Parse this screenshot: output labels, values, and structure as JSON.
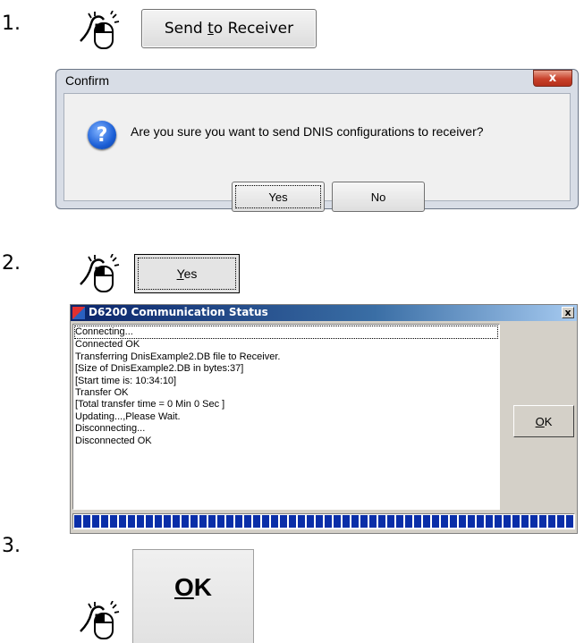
{
  "steps": [
    {
      "number": "1."
    },
    {
      "number": "2."
    },
    {
      "number": "3."
    }
  ],
  "step1": {
    "button_prefix": "Send ",
    "button_mnemonic": "t",
    "button_suffix": "o Receiver"
  },
  "confirm_dialog": {
    "title": "Confirm",
    "close_label": "x",
    "message": "Are you sure you want to send DNIS configurations to receiver?",
    "yes_label": "Yes",
    "no_label": "No",
    "icon": "question-icon"
  },
  "step2": {
    "button_mnemonic": "Y",
    "button_suffix": "es"
  },
  "comm_window": {
    "title": "D6200 Communication Status",
    "close_label": "x",
    "log_lines": [
      "Connecting...",
      "Connected OK",
      "Transferring DnisExample2.DB file to Receiver.",
      " [Size of  DnisExample2.DB in bytes:37]",
      " [Start time is: 10:34:10]",
      "Transfer OK",
      " [Total transfer time = 0 Min 0 Sec ]",
      "Updating...,Please Wait.",
      "Disconnecting...",
      "Disconnected OK"
    ],
    "ok_mnemonic": "O",
    "ok_suffix": "K",
    "progress": 1.0
  },
  "step3": {
    "ok_mnemonic": "O",
    "ok_suffix": "K"
  },
  "colors": {
    "titlebar_start": "#0a246a",
    "progress_fill": "#0a2ea8"
  }
}
